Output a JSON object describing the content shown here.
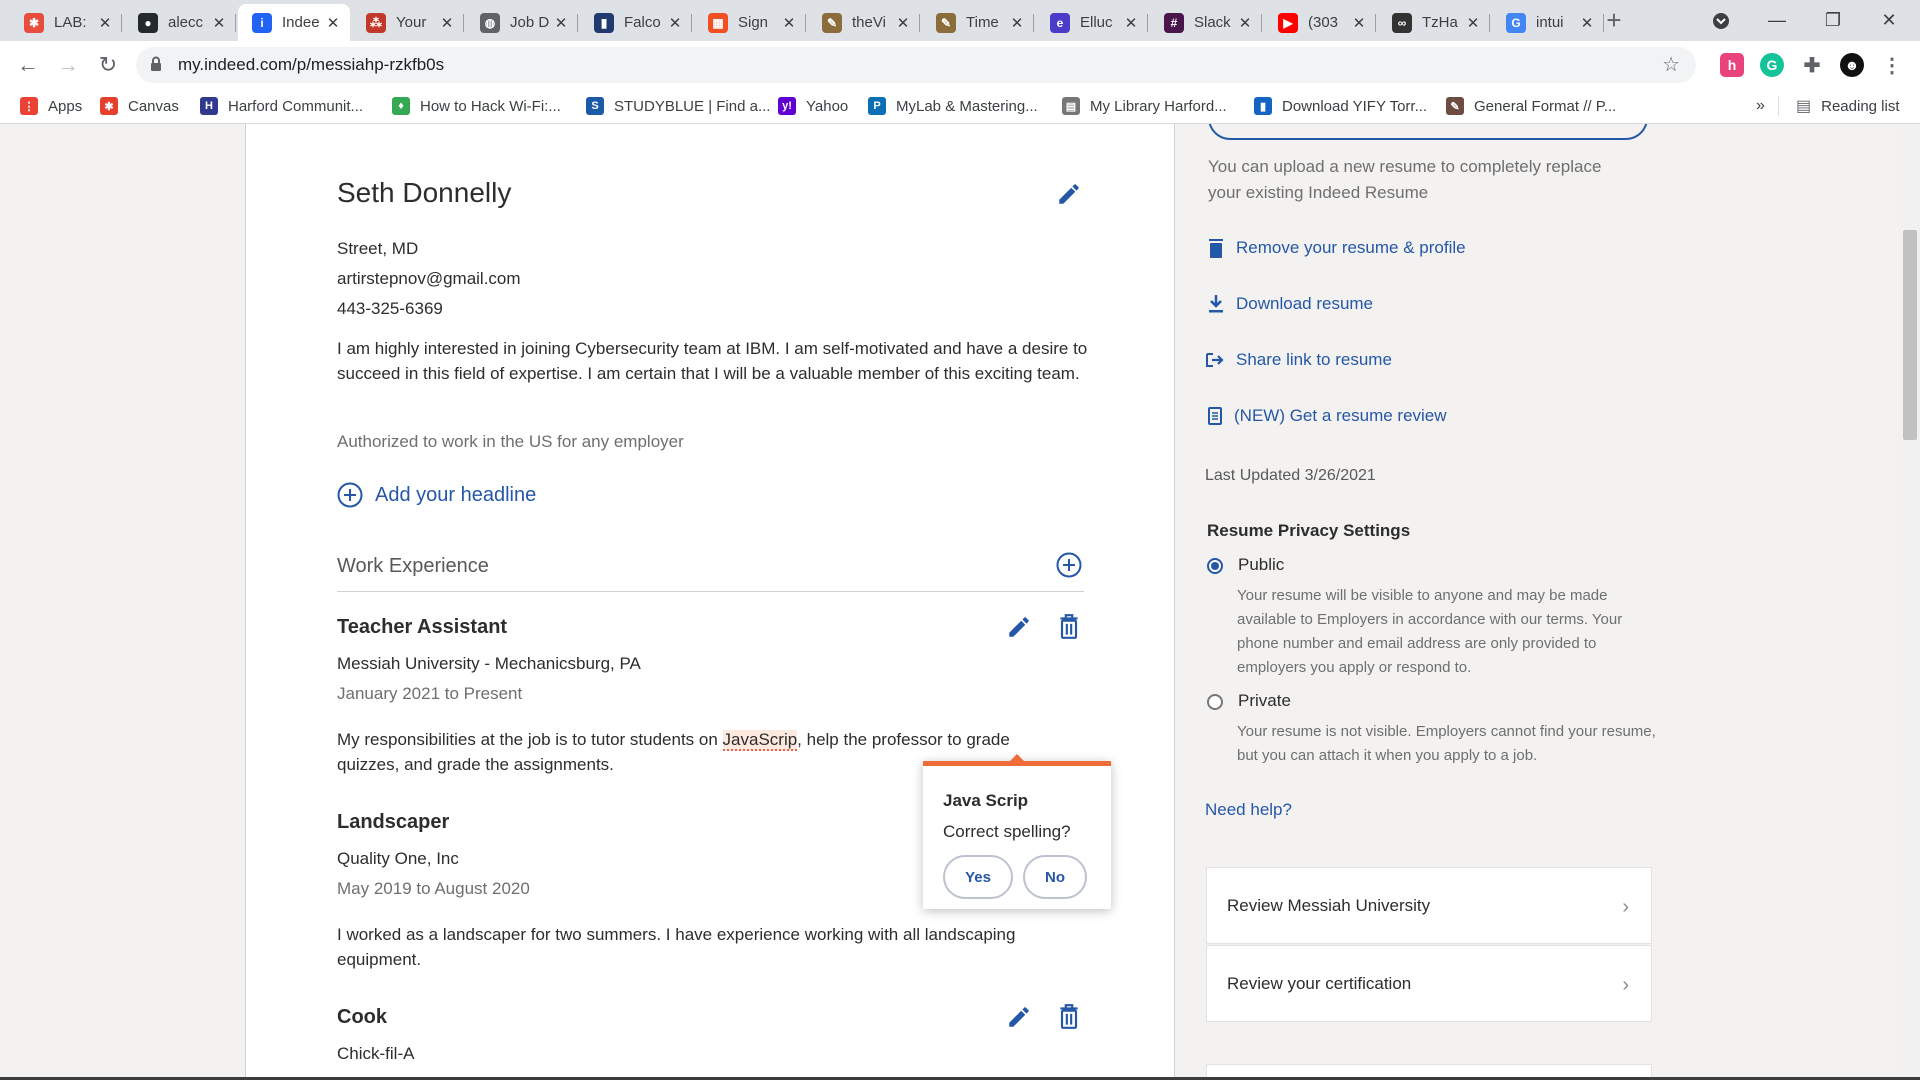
{
  "browser": {
    "tabs": [
      {
        "title": "LAB:",
        "favicon_color": "#e74c3c",
        "favicon_glyph": "✱"
      },
      {
        "title": "alecc",
        "favicon_color": "#24292e",
        "favicon_glyph": "●"
      },
      {
        "title": "Indee",
        "favicon_color": "#2164f3",
        "favicon_glyph": "i"
      },
      {
        "title": "Your",
        "favicon_color": "#c0392b",
        "favicon_glyph": "⁂"
      },
      {
        "title": "Job D",
        "favicon_color": "#5f6368",
        "favicon_glyph": "◍"
      },
      {
        "title": "Falco",
        "favicon_color": "#1f3a6e",
        "favicon_glyph": "▮"
      },
      {
        "title": "Sign",
        "favicon_color": "#f25022",
        "favicon_glyph": "▦"
      },
      {
        "title": "theVi",
        "favicon_color": "#8a6d3b",
        "favicon_glyph": "✎"
      },
      {
        "title": "Time",
        "favicon_color": "#8a6d3b",
        "favicon_glyph": "✎"
      },
      {
        "title": "Elluc",
        "favicon_color": "#4a3cc9",
        "favicon_glyph": "e"
      },
      {
        "title": "Slack",
        "favicon_color": "#4a154b",
        "favicon_glyph": "#"
      },
      {
        "title": "(303",
        "favicon_color": "#ff0000",
        "favicon_glyph": "▶"
      },
      {
        "title": "TzHa",
        "favicon_color": "#333333",
        "favicon_glyph": "∞"
      },
      {
        "title": "intui",
        "favicon_color": "#4285f4",
        "favicon_glyph": "G"
      }
    ],
    "url": "my.indeed.com/p/messiahp-rzkfb0s",
    "bookmarks": [
      {
        "label": "Apps",
        "color": "#ea4335",
        "glyph": "⋮"
      },
      {
        "label": "Canvas",
        "color": "#e4402b",
        "glyph": "✱"
      },
      {
        "label": "Harford Communit...",
        "color": "#2f3a8f",
        "glyph": "H"
      },
      {
        "label": "How to Hack Wi-Fi:...",
        "color": "#34a853",
        "glyph": "♦"
      },
      {
        "label": "STUDYBLUE | Find a...",
        "color": "#1a5aa6",
        "glyph": "S"
      },
      {
        "label": "Yahoo",
        "color": "#6001d2",
        "glyph": "y!"
      },
      {
        "label": "MyLab & Mastering...",
        "color": "#0a6fb5",
        "glyph": "P"
      },
      {
        "label": "My Library Harford...",
        "color": "#777777",
        "glyph": "▤"
      },
      {
        "label": "Download YIFY Torr...",
        "color": "#1565c0",
        "glyph": "▮"
      },
      {
        "label": "General Format // P...",
        "color": "#6d4c41",
        "glyph": "✎"
      }
    ],
    "bookmarks_overflow": "»",
    "reading_list": "Reading list"
  },
  "profile": {
    "name": "Seth Donnelly",
    "location": "Street, MD",
    "email": "artirstepnov@gmail.com",
    "phone": "443-325-6369",
    "summary": "I am highly interested in joining Cybersecurity team at IBM. I am self-motivated and have a desire to succeed in this field of expertise. I am certain that I will be a valuable member of this exciting team.",
    "work_auth": "Authorized to work in the US for any employer",
    "add_headline": "Add your headline"
  },
  "work_section": {
    "title": "Work Experience",
    "jobs": [
      {
        "title": "Teacher Assistant",
        "company": "Messiah University - Mechanicsburg, PA",
        "dates": "January 2021 to Present",
        "desc_before": "My responsibilities at the job is to tutor students on ",
        "desc_flagged": "JavaScrip",
        "desc_after": ", help the professor to grade quizzes, and grade the assignments."
      },
      {
        "title": "Landscaper",
        "company": "Quality One, Inc",
        "dates": "May 2019 to August 2020",
        "desc_before": "I worked as a landscaper for two summers. ",
        "desc_hidden": "I have experience working ",
        "desc_after": "with all landscaping equipment."
      },
      {
        "title": "Cook",
        "company": "Chick-fil-A"
      }
    ]
  },
  "spell_popup": {
    "suggestion": "Java Scrip",
    "question": "Correct spelling?",
    "yes": "Yes",
    "no": "No"
  },
  "sidebar": {
    "upload_note": "You can upload a new resume to completely replace your existing Indeed Resume",
    "links": {
      "remove": "Remove your resume & profile",
      "download": "Download resume",
      "share": "Share link to resume",
      "review": "(NEW) Get a resume review"
    },
    "last_updated": "Last Updated 3/26/2021",
    "privacy": {
      "title": "Resume Privacy Settings",
      "public_label": "Public",
      "public_desc": "Your resume will be visible to anyone and may be made available to Employers in accordance with our terms. Your phone number and email address are only provided to employers you apply or respond to.",
      "private_label": "Private",
      "private_desc": "Your resume is not visible. Employers cannot find your resume, but you can attach it when you apply to a job.",
      "selected": "Public"
    },
    "help": "Need help?",
    "review_cards": [
      "Review Messiah University",
      "Review your certification"
    ]
  }
}
